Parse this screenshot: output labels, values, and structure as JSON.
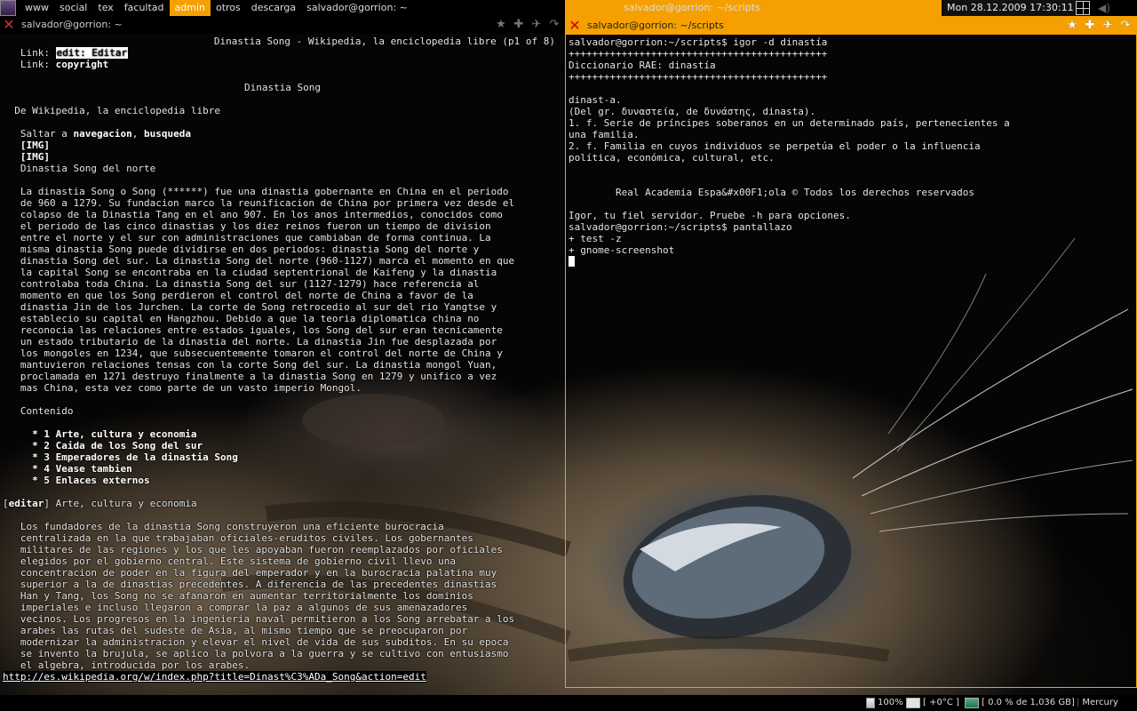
{
  "top_panel": {
    "tags": [
      {
        "label": "www",
        "active": false
      },
      {
        "label": "social",
        "active": false
      },
      {
        "label": "tex",
        "active": false
      },
      {
        "label": "facultad",
        "active": false
      },
      {
        "label": "admin",
        "active": true
      },
      {
        "label": "otros",
        "active": false
      },
      {
        "label": "descarga",
        "active": false
      }
    ],
    "left_title": "salvador@gorrion: ~",
    "focused_title": "salvador@gorrion: ~/scripts",
    "clock": "Mon 28.12.2009 17:30:11",
    "accent_color": "#f5a000"
  },
  "left_window": {
    "title": "salvador@gorrion: ~",
    "page_header": "Dinastia Song - Wikipedia, la enciclopedia libre (p1 of 8)",
    "link1_label": "Link:",
    "link1_value": "edit: Editar",
    "link2_label": "Link:",
    "link2_value": "copyright",
    "heading": "Dinastia Song",
    "subheading": "De Wikipedia, la enciclopedia libre",
    "skip_prefix": "Saltar a",
    "skip_nav": "navegacion",
    "skip_sep": ",",
    "skip_search": "busqueda",
    "img1": "[IMG]",
    "img2": "[IMG]",
    "caption": "Dinastia Song del norte",
    "paragraph1": [
      "La dinastia Song o Song (******) fue una dinastia gobernante en China en el periodo",
      "de 960 a 1279. Su fundacion marco la reunificacion de China por primera vez desde el",
      "colapso de la Dinastia Tang en el ano 907. En los anos intermedios, conocidos como",
      "el periodo de las cinco dinastias y los diez reinos fueron un tiempo de division",
      "entre el norte y el sur con administraciones que cambiaban de forma continua. La",
      "misma dinastia Song puede dividirse en dos periodos: dinastia Song del norte y",
      "dinastia Song del sur. La dinastia Song del norte (960-1127) marca el momento en que",
      "la capital Song se encontraba en la ciudad septentrional de Kaifeng y la dinastia",
      "controlaba toda China. La dinastia Song del sur (1127-1279) hace referencia al",
      "momento en que los Song perdieron el control del norte de China a favor de la",
      "dinastia Jin de los Jurchen. La corte de Song retrocedio al sur del rio Yangtse y",
      "establecio su capital en Hangzhou. Debido a que la teoria diplomatica china no",
      "reconocia las relaciones entre estados iguales, los Song del sur eran tecnicamente",
      "un estado tributario de la dinastia del norte. La dinastia Jin fue desplazada por",
      "los mongoles en 1234, que subsecuentemente tomaron el control del norte de China y",
      "mantuvieron relaciones tensas con la corte Song del sur. La dinastia mongol Yuan,",
      "proclamada en 1271 destruyo finalmente a la dinastia Song en 1279 y unifico a vez",
      "mas China, esta vez como parte de un vasto imperio Mongol."
    ],
    "contents_title": "Contenido",
    "contents": [
      "* 1 Arte, cultura y economia",
      "* 2 Caida de los Song del sur",
      "* 3 Emperadores de la dinastia Song",
      "* 4 Vease tambien",
      "* 5 Enlaces externos"
    ],
    "section_edit": "editar",
    "section_title": "Arte, cultura y economia",
    "paragraph2": [
      "Los fundadores de la dinastia Song construyeron una eficiente burocracia",
      "centralizada en la que trabajaban oficiales-eruditos civiles. Los gobernantes",
      "militares de las regiones y los que les apoyaban fueron reemplazados por oficiales",
      "elegidos por el gobierno central. Este sistema de gobierno civil llevo una",
      "concentracion de poder en la figura del emperador y en la burocracia palatina muy",
      "superior a la de dinastias precedentes. A diferencia de las precedentes dinastias",
      "Han y Tang, los Song no se afanaron en aumentar territorialmente los dominios",
      "imperiales e incluso llegaron a comprar la paz a algunos de sus amenazadores",
      "vecinos. Los progresos en la ingenieria naval permitieron a los Song arrebatar a los",
      "arabes las rutas del sudeste de Asia, al mismo tiempo que se preocuparon por",
      "modernizar la administracion y elevar el nivel de vida de sus subditos. En su epoca",
      "se invento la brujula, se aplico la polvora a la guerra y se cultivo con entusiasmo",
      "el algebra, introducida por los arabes."
    ],
    "status_url": "http://es.wikipedia.org/w/index.php?title=Dinast%C3%ADa_Song&action=edit"
  },
  "right_window": {
    "title": "salvador@gorrion: ~/scripts",
    "lines": [
      "salvador@gorrion:~/scripts$ igor -d dinastía",
      "++++++++++++++++++++++++++++++++++++++++++++",
      "Diccionario RAE: dinastía",
      "++++++++++++++++++++++++++++++++++++++++++++",
      "",
      "dinast-a.",
      "(Del gr. δυναστεία, de δυνάστης, dinasta).",
      "1. f. Serie de príncipes soberanos en un determinado país, pertenecientes a",
      "una familia.",
      "2. f. Familia en cuyos individuos se perpetúa el poder o la influencia",
      "política, económica, cultural, etc.",
      "",
      "",
      "        Real Academia Espa&#x00F1;ola © Todos los derechos reservados",
      "",
      "Igor, tu fiel servidor. Pruebe -h para opciones.",
      "salvador@gorrion:~/scripts$ pantallazo",
      "+ test -z",
      "+ gnome-screenshot"
    ]
  },
  "bottom_panel": {
    "battery": "100%",
    "temperature": "[ +0°C ]",
    "disk": "[ 0.0 % de 1,036 GB]",
    "app": "Mercury"
  }
}
